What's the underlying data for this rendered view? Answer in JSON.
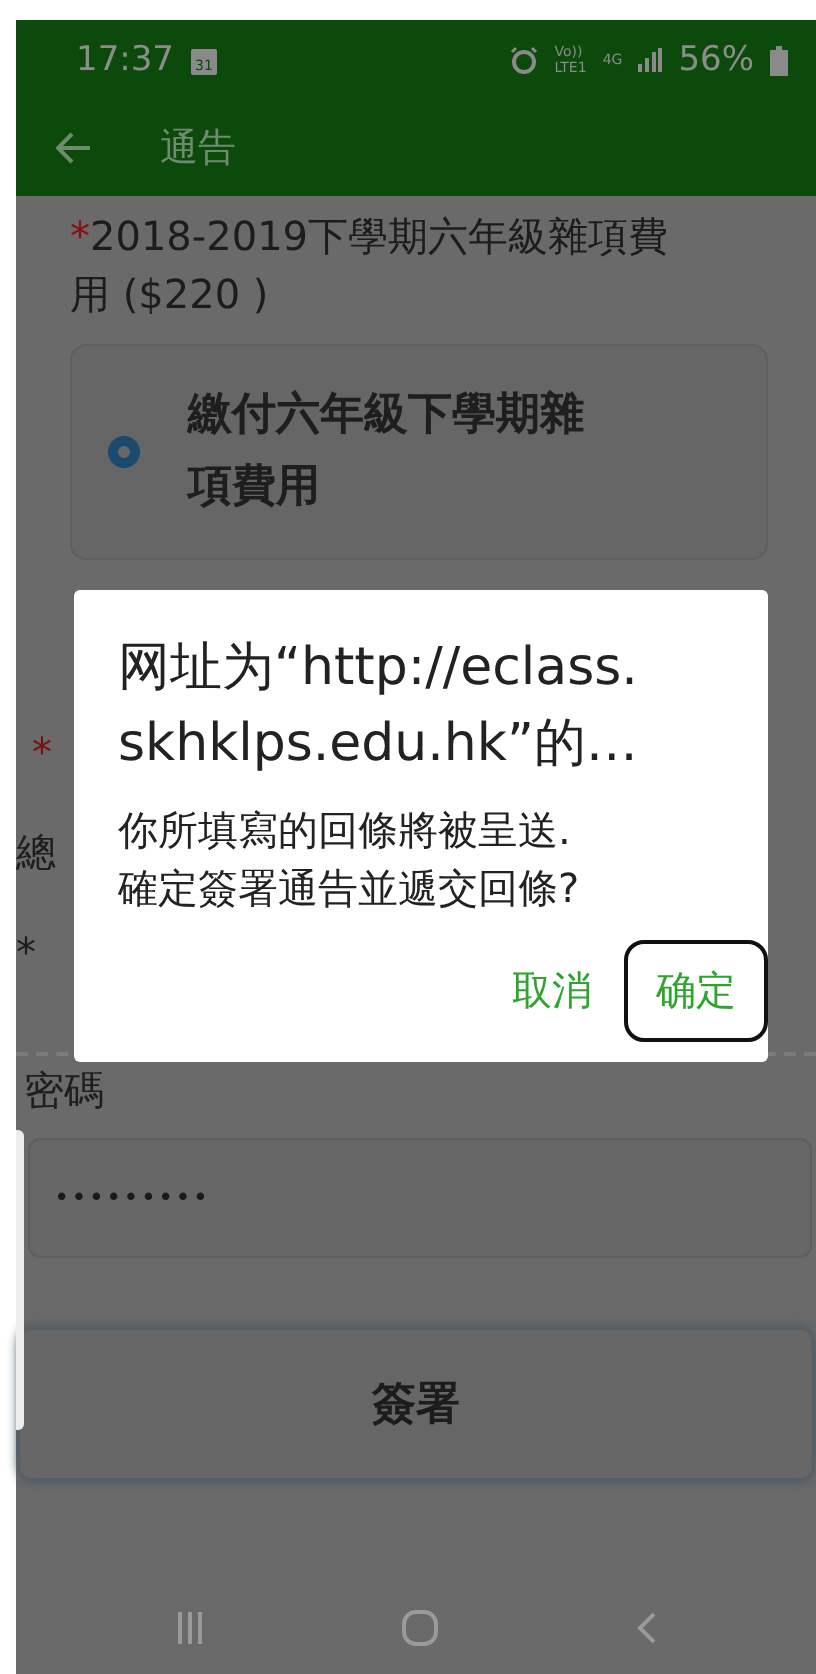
{
  "status_bar": {
    "time": "17:37",
    "calendar_day": "31",
    "volte": [
      "Vo))",
      "LTE1"
    ],
    "network": "4G",
    "battery": "56%"
  },
  "app_bar": {
    "title": "通告"
  },
  "question": {
    "required_mark": "*",
    "text": "2018-2019下學期六年級雜項費用 ($220 )"
  },
  "options": [
    {
      "label": "繳付六年級下學期雜項費用",
      "selected": true
    }
  ],
  "texts_behind_dialog": [
    {
      "kind": "required",
      "text": "*"
    },
    {
      "kind": "label",
      "text": "總"
    },
    {
      "kind": "mark",
      "text": "*"
    }
  ],
  "password": {
    "label": "密碼",
    "value": "•••••••••"
  },
  "sign_button": {
    "label": "簽署"
  },
  "dialog": {
    "title_lines": [
      "网址为“http://eclass.",
      "skhklps.edu.hk”的…"
    ],
    "message_lines": [
      "你所填寫的回條將被呈送.",
      "確定簽署通告並遞交回條?"
    ],
    "buttons": [
      {
        "label": "取消",
        "highlighted": false
      },
      {
        "label": "确定",
        "highlighted": true
      }
    ]
  }
}
